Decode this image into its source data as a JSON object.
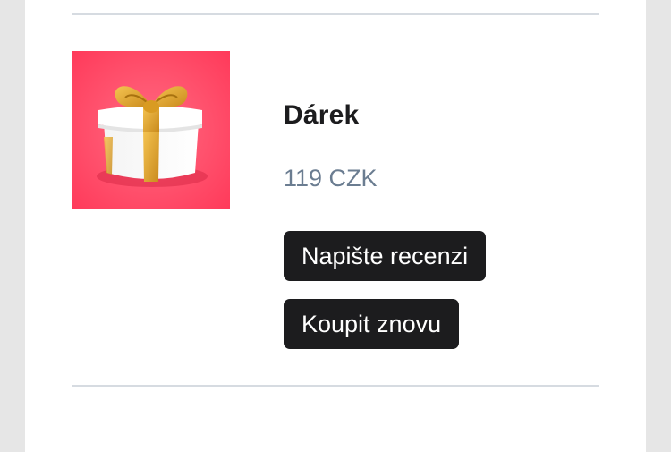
{
  "order_item": {
    "image_alt": "gift box",
    "name": "Dárek",
    "price": "119 CZK",
    "review_button_label": "Napište recenzi",
    "buy_again_button_label": "Koupit znovu"
  },
  "colors": {
    "image_background": "#ff3d5e",
    "gift_ribbon": "#e0a52a",
    "button_background": "#1c1c1e",
    "price_text": "#6b7d91",
    "divider": "#d6dbe1"
  },
  "icons": {
    "product_image": "gift-box-image"
  }
}
